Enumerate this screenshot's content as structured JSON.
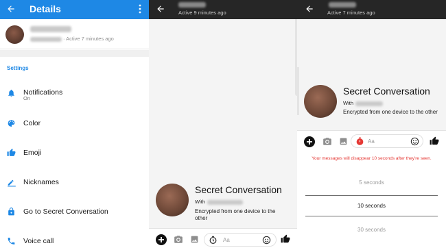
{
  "details": {
    "title": "Details",
    "contact_active": "· Active 7 minutes ago",
    "section_label": "Settings",
    "items": [
      {
        "label": "Notifications",
        "sub": "On",
        "icon": "bell-icon"
      },
      {
        "label": "Color",
        "icon": "palette-icon"
      },
      {
        "label": "Emoji",
        "icon": "thumbs-up-icon"
      },
      {
        "label": "Nicknames",
        "icon": "pencil-icon"
      },
      {
        "label": "Go to Secret Conversation",
        "icon": "lock-icon"
      },
      {
        "label": "Voice call",
        "icon": "phone-icon"
      }
    ]
  },
  "conversation": {
    "active": "Active 9 minutes ago",
    "title": "Secret Conversation",
    "with": "With",
    "encrypted": "Encrypted from one device to the other",
    "placeholder": "Aa"
  },
  "timer_view": {
    "active": "Active 7 minutes ago",
    "title": "Secret Conversation",
    "with": "With",
    "encrypted": "Encrypted from one device to the other",
    "placeholder": "Aa",
    "warning": "Your messages will disappear 10 seconds after they're seen.",
    "options": [
      {
        "label": "5 seconds",
        "selected": false
      },
      {
        "label": "10 seconds",
        "selected": true
      },
      {
        "label": "30 seconds",
        "selected": false
      }
    ]
  },
  "colors": {
    "accent": "#1e88e5",
    "dark_bar": "#262626",
    "warning": "#e53935"
  }
}
